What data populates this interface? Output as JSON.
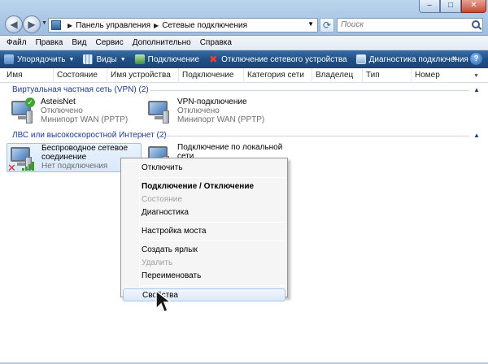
{
  "window": {
    "address": {
      "crumbs": [
        "Панель управления",
        "Сетевые подключения"
      ]
    },
    "search_placeholder": "Поиск",
    "controls": {
      "minimize": "–",
      "maximize": "□",
      "close": "✕"
    }
  },
  "menubar": {
    "items": [
      "Файл",
      "Правка",
      "Вид",
      "Сервис",
      "Дополнительно",
      "Справка"
    ]
  },
  "toolbar": {
    "organize": "Упорядочить",
    "views": "Виды",
    "connect": "Подключение",
    "disconnect": "Отключение сетевого устройства",
    "diagnose": "Диагностика подключения",
    "more": "»",
    "help": "?"
  },
  "columns": [
    "Имя",
    "Состояние",
    "Имя устройства",
    "Подключение",
    "Категория сети",
    "Владелец",
    "Тип",
    "Номер телефона"
  ],
  "groups": [
    {
      "title": "Виртуальная частная сеть (VPN) (2)",
      "items": [
        {
          "name": "AsteisNet",
          "status": "Отключено",
          "device": "Минипорт WAN (PPTP)"
        },
        {
          "name": "VPN-подключение",
          "status": "Отключено",
          "device": "Минипорт WAN (PPTP)"
        }
      ]
    },
    {
      "title": "ЛВС или высокоскоростной Интернет (2)",
      "items": [
        {
          "name_line1": "Беспроводное сетевое",
          "name_line2": "соединение",
          "status": "Нет подключения"
        },
        {
          "name_line1": "Подключение по локальной",
          "name_line2": "сети"
        }
      ]
    }
  ],
  "context_menu": {
    "disconnect": "Отключить",
    "connect_toggle": "Подключение / Отключение",
    "status": "Состояние",
    "diagnose": "Диагностика",
    "bridge": "Настройка моста",
    "shortcut": "Создать ярлык",
    "delete": "Удалить",
    "rename": "Переименовать",
    "properties": "Свойства"
  }
}
